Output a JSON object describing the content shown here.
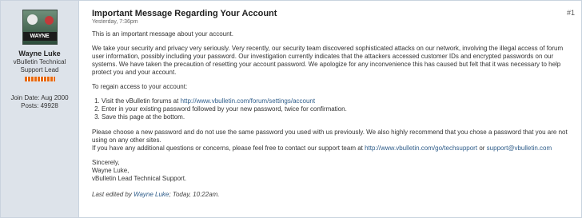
{
  "user": {
    "name": "Wayne Luke",
    "title_line1": "vBulletin Technical",
    "title_line2": "Support Lead",
    "avatar_text": "WAYNE",
    "join_label": "Join Date:",
    "join_value": "Aug 2000",
    "posts_label": "Posts:",
    "posts_value": "49928"
  },
  "post": {
    "title": "Important Message Regarding Your Account",
    "date": "Yesterday, 7:36pm",
    "number": "#1",
    "p1": "This is an important message about your account.",
    "p2": "We take your security and privacy very seriously. Very recently, our security team discovered sophisticated attacks on our network, involving the illegal access of forum user information, possibly including your password. Our investigation currently indicates that the attackers accessed customer IDs and encrypted passwords on our systems. We have taken the precaution of resetting your account password. We apologize for any inconvenience this has caused but felt that it was necessary to help protect you and your account.",
    "p3": "To regain access to your account:",
    "step1_text": "Visit the vBulletin forums at",
    "step1_link": "http://www.vbulletin.com/forum/settings/account",
    "step2": "Enter in your existing password followed by your new password, twice for confirmation.",
    "step3": "Save this page at the bottom.",
    "p4_line1": "Please choose a new password and do not use the same password you used with us previously. We also highly recommend that you chose a password that you are not using on any other sites.",
    "p4_line2_text": "If you have any additional questions or concerns, please feel free to contact our support team at",
    "support_link": "http://www.vbulletin.com/go/techsupport",
    "or_text": "or",
    "support_email": "support@vbulletin.com",
    "sign1": "Sincerely,",
    "sign2": "Wayne Luke,",
    "sign3": "vBulletin Lead Technical Support.",
    "edited_prefix": "Last edited by",
    "edited_user": "Wayne Luke",
    "edited_suffix": "; Today, 10:22am."
  }
}
